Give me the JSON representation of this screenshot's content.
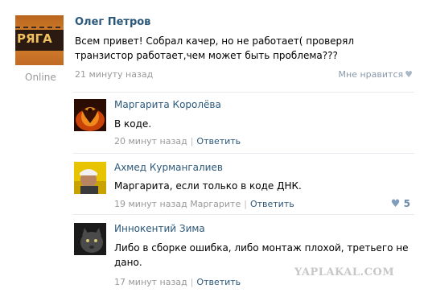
{
  "post": {
    "author": "Олег Петров",
    "status": "Online",
    "text": "Всем привет! Собрал качер, но не работает( проверял транзистор работает,чем может быть проблема???",
    "time": "21 минуту назад",
    "like_label": "Мне нравится",
    "avatar_text": "РЯГА",
    "avatar_icon": "avatar-group-logo"
  },
  "comments": [
    {
      "author": "Маргарита Королёва",
      "text": "В коде.",
      "time": "20 минут назад",
      "reply_to": "",
      "reply_label": "Ответить",
      "likes": ""
    },
    {
      "author": "Ахмед Курмангалиев",
      "text": "Маргарита, если только в коде ДНК.",
      "time": "19 минут назад",
      "reply_to": "Маргарите",
      "reply_label": "Ответить",
      "likes": "5"
    },
    {
      "author": "Иннокентий Зима",
      "text": "Либо в сборке ошибка, либо монтаж плохой, третьего не дано.",
      "time": "17 минут назад",
      "reply_to": "",
      "reply_label": "Ответить",
      "likes": ""
    }
  ],
  "watermark": "YAPLAKAL.COM",
  "colors": {
    "link": "#2b587a",
    "muted": "#999999",
    "divider": "#e6eaee"
  }
}
